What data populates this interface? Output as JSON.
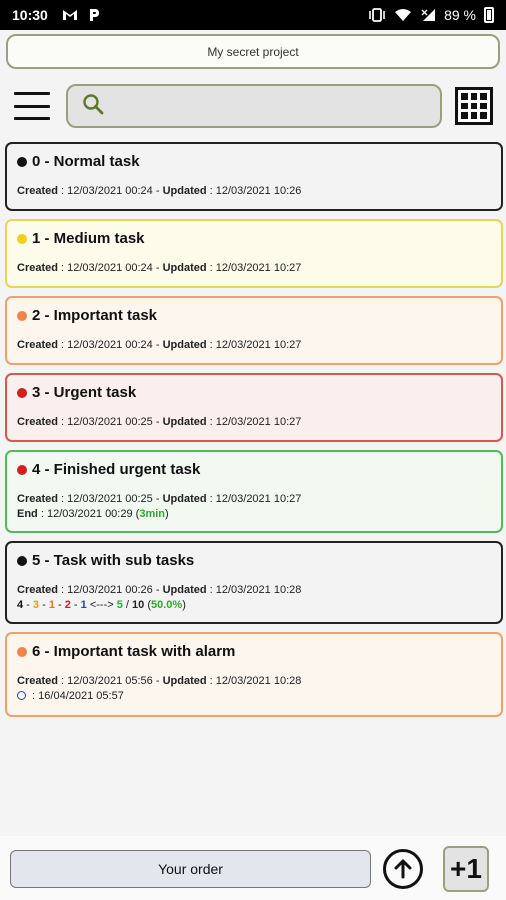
{
  "status_bar": {
    "time": "10:30",
    "battery_text": "89 %",
    "icons": [
      "gmail-icon",
      "p-app-icon",
      "vibrate-icon",
      "wifi-icon",
      "signal-icon",
      "battery-icon"
    ]
  },
  "project": {
    "name": "My secret project"
  },
  "search": {
    "value": "",
    "placeholder": ""
  },
  "tasks": [
    {
      "id": "0",
      "title": "0 - Normal task",
      "priority_color": "#111111",
      "created": "12/03/2021 00:24",
      "updated": "12/03/2021 10:26"
    },
    {
      "id": "1",
      "title": "1 - Medium task",
      "priority_color": "#f2d01e",
      "created": "12/03/2021 00:24",
      "updated": "12/03/2021 10:27"
    },
    {
      "id": "2",
      "title": "2 - Important task",
      "priority_color": "#f0844a",
      "created": "12/03/2021 00:24",
      "updated": "12/03/2021 10:27"
    },
    {
      "id": "3",
      "title": "3 - Urgent task",
      "priority_color": "#d81c1c",
      "created": "12/03/2021 00:25",
      "updated": "12/03/2021 10:27"
    },
    {
      "id": "4",
      "title": "4 - Finished urgent task",
      "priority_color": "#d81c1c",
      "created": "12/03/2021 00:25",
      "updated": "12/03/2021 10:27",
      "end": "12/03/2021 00:29",
      "duration": "3min"
    },
    {
      "id": "5",
      "title": "5 - Task with sub tasks",
      "priority_color": "#111111",
      "created": "12/03/2021 00:26",
      "updated": "12/03/2021 10:28",
      "subtasks": {
        "black": "4",
        "yellow": "3",
        "orange": "1",
        "red": "2",
        "blue": "1",
        "arrow": "<--->",
        "done": "5",
        "total": "10",
        "percent": "50.0%"
      }
    },
    {
      "id": "6",
      "title": "6 - Important task with alarm",
      "priority_color": "#f0844a",
      "created": "12/03/2021 05:56",
      "updated": "12/03/2021 10:28",
      "alarm": "16/04/2021 05:57"
    }
  ],
  "labels": {
    "created": "Created",
    "updated": "Updated",
    "end": "End",
    "sep": " - ",
    "colon": " : "
  },
  "bottom": {
    "order_label": "Your order",
    "add_label": "+1"
  },
  "colors": {
    "accent_border": "#9aa07a",
    "finished_green": "#2ea82e"
  }
}
